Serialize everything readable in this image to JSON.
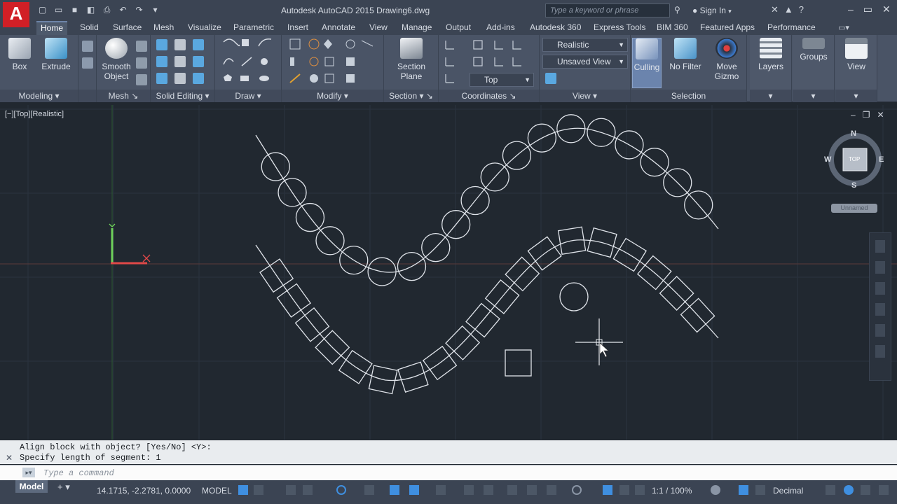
{
  "title_bar": {
    "logo": "A",
    "title": "Autodesk AutoCAD 2015    Drawing6.dwg",
    "search_placeholder": "Type a keyword or phrase",
    "sign_in": "Sign In",
    "qat_icons": [
      "new-icon",
      "open-icon",
      "save-icon",
      "save-as-icon",
      "print-icon",
      "undo-icon",
      "redo-icon",
      "dropdown-icon"
    ]
  },
  "tabs": [
    "Home",
    "Solid",
    "Surface",
    "Mesh",
    "Visualize",
    "Parametric",
    "Insert",
    "Annotate",
    "View",
    "Manage",
    "Output",
    "Add-ins",
    "Autodesk 360",
    "Express Tools",
    "BIM 360",
    "Featured Apps",
    "Performance"
  ],
  "active_tab": "Home",
  "ribbon": {
    "modeling": {
      "title": "Modeling",
      "box": "Box",
      "extrude": "Extrude"
    },
    "mesh": {
      "title": "Mesh",
      "smooth_object_1": "Smooth",
      "smooth_object_2": "Object"
    },
    "solid_editing": {
      "title": "Solid Editing"
    },
    "draw": {
      "title": "Draw"
    },
    "modify": {
      "title": "Modify"
    },
    "section": {
      "title": "Section",
      "section_plane_1": "Section",
      "section_plane_2": "Plane"
    },
    "coordinates": {
      "title": "Coordinates",
      "combo_value": "Top"
    },
    "view": {
      "title": "View",
      "visual_style": "Realistic",
      "named_view": "Unsaved View"
    },
    "selection": {
      "title": "Selection",
      "culling": "Culling",
      "no_filter": "No Filter",
      "move_gizmo_1": "Move",
      "move_gizmo_2": "Gizmo"
    },
    "layers": "Layers",
    "groups": "Groups",
    "view_btn": "View"
  },
  "viewport": {
    "label": "[−][Top][Realistic]",
    "viewcube": {
      "n": "N",
      "s": "S",
      "e": "E",
      "w": "W",
      "face": "TOP"
    },
    "unnamed": "Unnamed"
  },
  "command": {
    "history_1": "Align block with object? [Yes/No] <Y>:",
    "history_2": "Specify length of segment: 1",
    "placeholder": "Type a command"
  },
  "statusbar": {
    "model_tab": "Model",
    "coords": "14.1715, -2.2781, 0.0000",
    "model_space": "MODEL",
    "annotation_scale": "1:1 / 100%",
    "units": "Decimal"
  },
  "colors": {
    "canvas": "#212830",
    "titlebar": "#3b4453",
    "ribbon": "#4a5466",
    "accent": "#d11f26",
    "drawing": "#e0e4ea"
  }
}
